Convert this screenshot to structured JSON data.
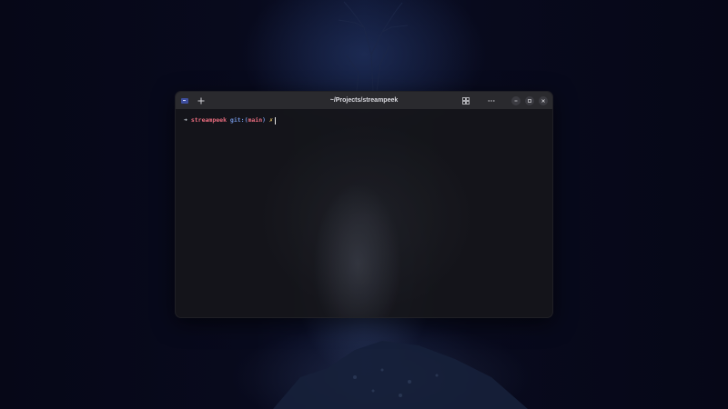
{
  "window": {
    "title": "~/Projects/streampeek"
  },
  "terminal": {
    "prompt_arrow": "➜",
    "directory": "streampeek",
    "git_prefix": "git:",
    "paren_open": "(",
    "branch": "main",
    "paren_close": ")",
    "dirty_marker": "✗"
  },
  "icons": {
    "app": "terminal-app-icon",
    "new_tab": "plus-icon",
    "grid": "grid-icon",
    "menu": "ellipsis-icon",
    "minimize": "minimize-icon",
    "maximize": "maximize-icon",
    "close": "close-icon"
  },
  "colors": {
    "accent_pink": "#e86c7e",
    "accent_blue": "#6e8fd6",
    "dirty_yellow": "#e6c46a",
    "titlebar": "#2a2a2e"
  }
}
